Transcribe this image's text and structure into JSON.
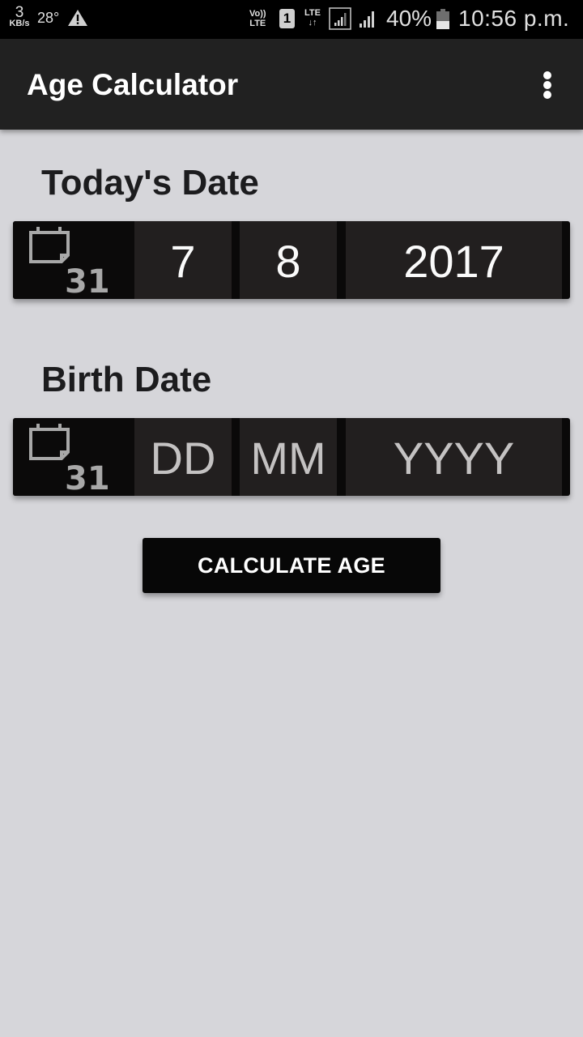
{
  "status_bar": {
    "net_speed_value": "3",
    "net_speed_unit": "KB/s",
    "temperature": "28°",
    "warning_icon": "warning-triangle-icon",
    "volte_top": "Vo))",
    "volte_bottom": "LTE",
    "sim_slot": "1",
    "lte_label": "LTE",
    "lte_arrows": "↓↑",
    "battery_percent": "40%",
    "battery_level": 0.4,
    "time": "10:56 p.m."
  },
  "app_bar": {
    "title": "Age Calculator",
    "overflow_icon": "more-vert-icon"
  },
  "todays_date": {
    "label": "Today's Date",
    "icon": "calendar-31-icon",
    "icon_text": "31",
    "day": "7",
    "month": "8",
    "year": "2017"
  },
  "birth_date": {
    "label": "Birth Date",
    "icon": "calendar-31-icon",
    "icon_text": "31",
    "day_placeholder": "DD",
    "month_placeholder": "MM",
    "year_placeholder": "YYYY",
    "day": "",
    "month": "",
    "year": ""
  },
  "actions": {
    "calculate_label": "CALCULATE AGE"
  },
  "colors": {
    "background": "#d6d6da",
    "app_bar": "#212121",
    "input_cell": "#221f1f",
    "button": "#070707"
  }
}
